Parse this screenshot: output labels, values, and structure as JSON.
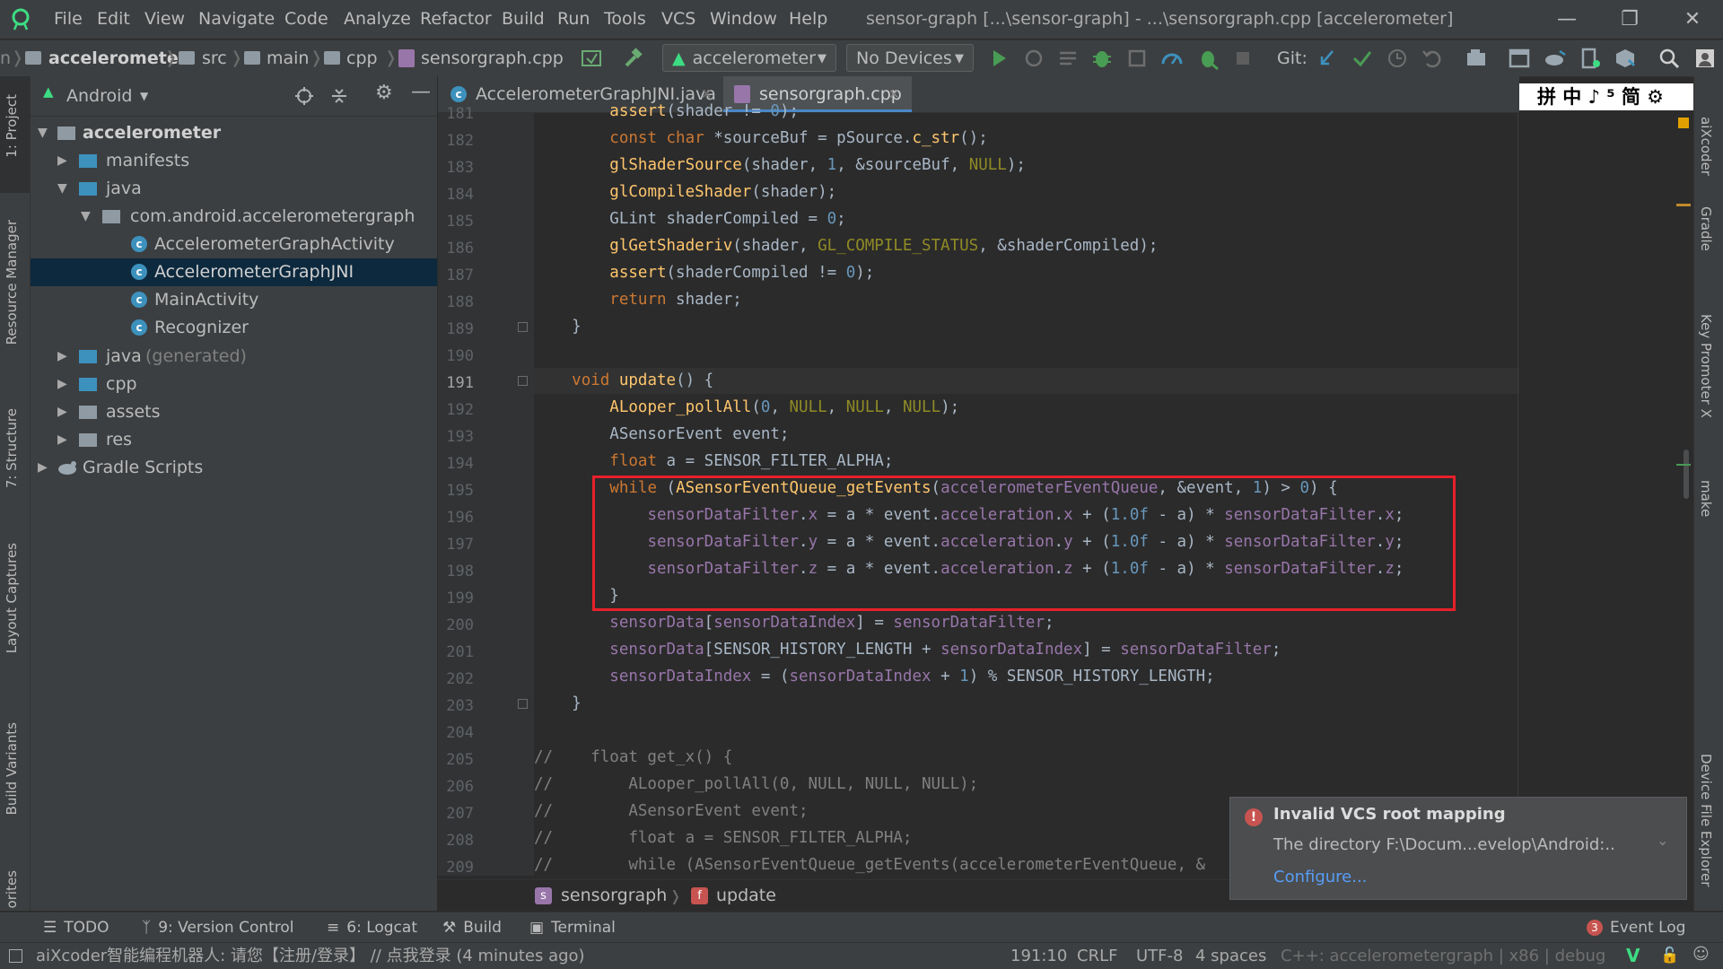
{
  "menu": [
    "File",
    "Edit",
    "View",
    "Navigate",
    "Code",
    "Analyze",
    "Refactor",
    "Build",
    "Run",
    "Tools",
    "VCS",
    "Window",
    "Help"
  ],
  "window_title": "sensor-graph [...\\sensor-graph] - ...\\sensorgraph.cpp [accelerometer]",
  "breadcrumb": [
    "accelerometer",
    "src",
    "main",
    "cpp",
    "sensorgraph.cpp"
  ],
  "toolbar": {
    "run_config": "accelerometer",
    "device": "No Devices",
    "git_label": "Git:"
  },
  "project_panel": {
    "view_mode": "Android",
    "tree": [
      {
        "label": "accelerometer",
        "bold": true
      },
      {
        "label": "manifests"
      },
      {
        "label": "java"
      },
      {
        "label": "com.android.accelerometergraph"
      },
      {
        "label": "AccelerometerGraphActivity"
      },
      {
        "label": "AccelerometerGraphJNI",
        "selected": true
      },
      {
        "label": "MainActivity"
      },
      {
        "label": "Recognizer"
      },
      {
        "label": "java",
        "suffix": "(generated)"
      },
      {
        "label": "cpp"
      },
      {
        "label": "assets"
      },
      {
        "label": "res"
      },
      {
        "label": "Gradle Scripts"
      }
    ]
  },
  "left_tool_tabs": [
    "1: Project",
    "Resource Manager",
    "7: Structure",
    "Layout Captures",
    "Build Variants",
    "orites"
  ],
  "right_tool_tabs": [
    "aiXcoder",
    "Gradle",
    "Key Promoter X",
    "make",
    "Device File Explorer"
  ],
  "editor_tabs": [
    {
      "label": "AccelerometerGraphJNI.java",
      "active": false
    },
    {
      "label": "sensorgraph.cpp",
      "active": true
    }
  ],
  "ime_toolbar": "拼 中 ♪ ⁵ 简 ⚙",
  "code": {
    "line_numbers": [
      "181",
      "182",
      "183",
      "184",
      "185",
      "186",
      "187",
      "188",
      "189",
      "190",
      "191",
      "192",
      "193",
      "194",
      "195",
      "196",
      "197",
      "198",
      "199",
      "200",
      "201",
      "202",
      "203",
      "204",
      "205",
      "206",
      "207",
      "208",
      "209"
    ],
    "current_line": "191"
  },
  "editor_breadcrumb": {
    "file": "sensorgraph",
    "function": "update"
  },
  "tool_windows": [
    "TODO",
    "9: Version Control",
    "6: Logcat",
    "Build",
    "Terminal"
  ],
  "event_log": {
    "label": "Event Log",
    "count": "3"
  },
  "notification": {
    "title": "Invalid VCS root mapping",
    "body": "The directory F:\\Docum...evelop\\Android:..",
    "link": "Configure..."
  },
  "statusbar": {
    "message": "aiXcoder智能编程机器人: 请您【注册/登录】 // 点我登录 (4 minutes ago)",
    "position": "191:10",
    "line_sep": "CRLF",
    "encoding": "UTF-8",
    "indent": "4 spaces",
    "context": "C++: accelerometergraph | x86 | debug"
  }
}
